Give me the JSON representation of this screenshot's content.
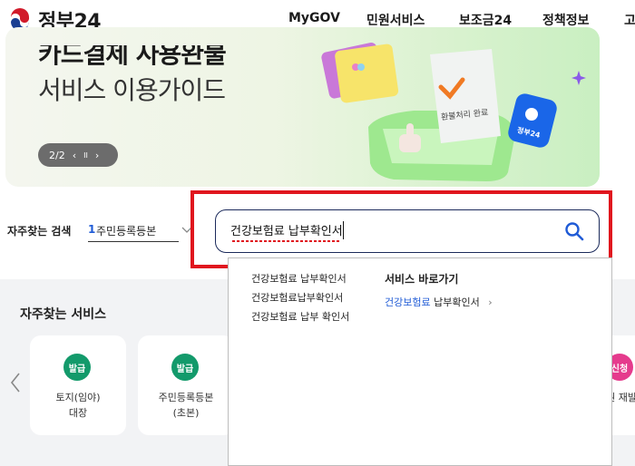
{
  "header": {
    "logo_text": "정부24",
    "nav": [
      "MyGOV",
      "민원서비스",
      "보조금24",
      "정책정보",
      "고"
    ]
  },
  "banner": {
    "title": "카드결제 사용완불",
    "subtitle": "서비스 이용가이드",
    "pager": {
      "current": "2/2",
      "prev": "‹",
      "pause": "II",
      "next": "›"
    },
    "receipt_text": "환불처리 완료",
    "badge_text": "정부24"
  },
  "search": {
    "frequent_label": "자주찾는 검색",
    "frequent_rank": "1",
    "frequent_term": "주민등록등본",
    "query": "건강보험료 납부확인서"
  },
  "dropdown": {
    "suggestions": [
      "건강보험료 납부확인서",
      "건강보험료납부확인서",
      "건강보험료 납부 확인서"
    ],
    "quick_title": "서비스 바로가기",
    "quick_link_highlight": "건강보험료",
    "quick_link_rest": " 납부확인서",
    "quick_link_chevron": "›"
  },
  "services": {
    "title": "자주찾는 서비스",
    "nav_prev": "‹",
    "cards": [
      {
        "badge": "발급",
        "label_line1": "토지(임야)",
        "label_line2": "대장"
      },
      {
        "badge": "발급",
        "label_line1": "주민등록등본",
        "label_line2": "(초본)"
      },
      {
        "badge": "신청",
        "label_line1": "여권 재발",
        "label_line2": ""
      }
    ]
  },
  "colors": {
    "accent_blue": "#1f5bd6",
    "highlight_red": "#e0161e",
    "badge_green": "#139a6b",
    "badge_pink": "#e53b8d"
  }
}
